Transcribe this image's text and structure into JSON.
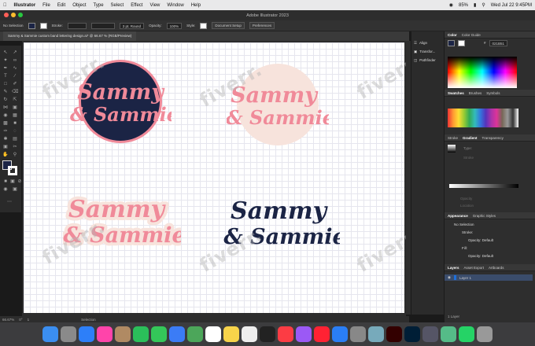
{
  "menubar": {
    "app": "Illustrator",
    "items": [
      "File",
      "Edit",
      "Object",
      "Type",
      "Select",
      "Effect",
      "View",
      "Window",
      "Help"
    ],
    "battery": "85%",
    "datetime": "Wed Jul 22  9:45PM"
  },
  "window": {
    "title": "Adobe Illustrator 2023"
  },
  "control": {
    "selection": "No Selection",
    "stroke_label": "Stroke:",
    "brush": "3 pt. Round",
    "opacity_label": "Opacity:",
    "opacity_value": "100%",
    "style_label": "Style:",
    "doc_setup": "Document Setup",
    "preferences": "Preferences"
  },
  "doc": {
    "tab": "Sammy & Sammie custom band lettering design.ai* @ 66.67 % (RGB/Preview)"
  },
  "logos": {
    "line1": "Sammy",
    "line2": "& Sammie"
  },
  "watermark": "fiverr.",
  "status": {
    "zoom": "66.67%",
    "angle": "0°",
    "artboard": "1",
    "mode": "Selection"
  },
  "collapsed": {
    "align": "Align",
    "transform": "Transfor...",
    "pathfinder": "Pathfinder"
  },
  "panels": {
    "color_tab": "Color",
    "color_guide_tab": "Color Guide",
    "hex": "021B51",
    "swatches_tab": "Swatches",
    "brushes_tab": "Brushes",
    "symbols_tab": "Symbols",
    "stroke_tab": "Stroke",
    "gradient_tab": "Gradient",
    "transparency_tab": "Transparency",
    "type_label": "Type:",
    "stroke_small": "Stroke",
    "opacity_small": "Opacity",
    "location_small": "Location",
    "appearance_tab": "Appearance",
    "graphic_styles_tab": "Graphic Styles",
    "app_no_selection": "No Selection",
    "app_stroke": "Stroke:",
    "app_opacity": "Opacity: Default",
    "app_fill": "Fill:",
    "app_opacity2": "Opacity: Default",
    "layers_tab": "Layers",
    "asset_export_tab": "Asset Export",
    "artboards_tab": "Artboards",
    "layer_name": "Layer 1",
    "layer_count": "1 Layer"
  },
  "colors": {
    "navy": "#1b2445",
    "pink": "#f08a99",
    "cream": "#f7e3dc",
    "accent": "#1e6fd9"
  },
  "dock_icons": [
    "finder-icon",
    "launchpad-icon",
    "safari-icon",
    "photos-icon",
    "contacts-icon",
    "facetime-icon",
    "messages-icon",
    "mail-icon",
    "maps-icon",
    "calendar-icon",
    "notes-icon",
    "reminders-icon",
    "tv-icon",
    "music-icon",
    "podcasts-icon",
    "news-icon",
    "app-store-icon",
    "settings-icon",
    "preview-icon",
    "illustrator-icon",
    "photoshop-icon",
    "utility-icon",
    "files-icon",
    "whatsapp-icon",
    "trash-icon"
  ]
}
